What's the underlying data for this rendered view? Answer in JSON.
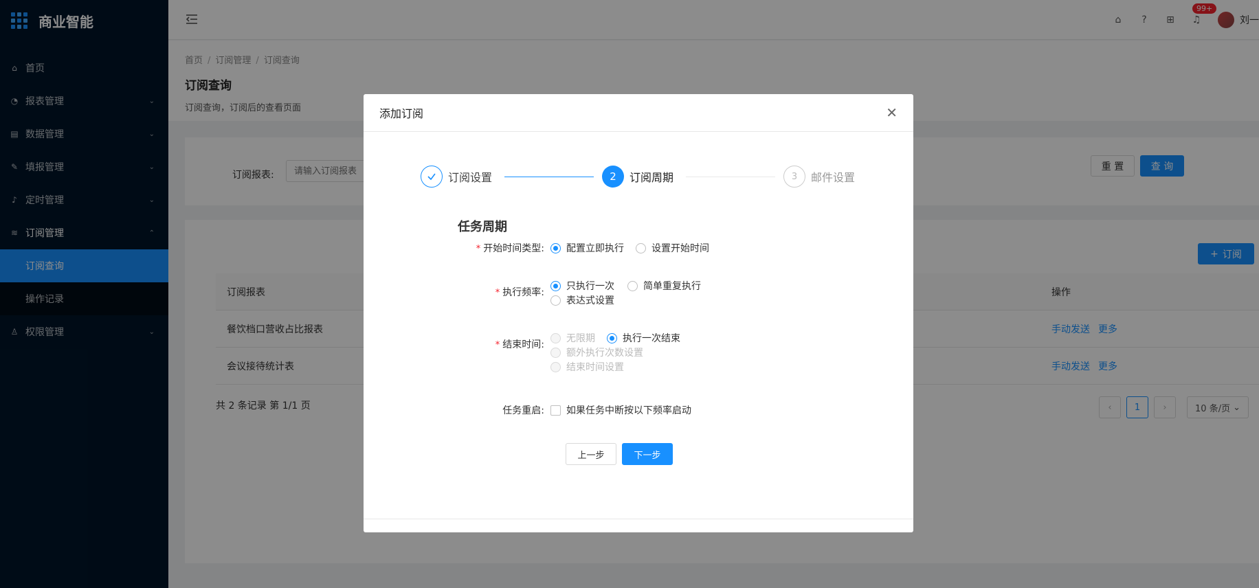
{
  "app": {
    "name": "商业智能"
  },
  "sidebar": {
    "items": [
      {
        "label": "首页",
        "icon": "home-icon"
      },
      {
        "label": "报表管理",
        "icon": "dashboard-icon"
      },
      {
        "label": "数据管理",
        "icon": "database-icon"
      },
      {
        "label": "填报管理",
        "icon": "edit-icon"
      },
      {
        "label": "定时管理",
        "icon": "bell-icon"
      },
      {
        "label": "订阅管理",
        "icon": "wifi-icon"
      },
      {
        "label": "权限管理",
        "icon": "user-icon"
      }
    ],
    "sub_items": [
      {
        "label": "订阅查询"
      },
      {
        "label": "操作记录"
      }
    ]
  },
  "header": {
    "badge": "99+",
    "user_name": "刘一"
  },
  "breadcrumb": [
    "首页",
    "订阅管理",
    "订阅查询"
  ],
  "page": {
    "title": "订阅查询",
    "description": "订阅查询，订阅后的查看页面"
  },
  "search": {
    "label": "订阅报表:",
    "placeholder": "请输入订阅报表",
    "reset_label": "重 置",
    "query_label": "查 询"
  },
  "table": {
    "add_label": "订阅",
    "columns": [
      "订阅报表",
      "操作"
    ],
    "rows": [
      {
        "report": "餐饮档口营收占比报表",
        "actions": [
          "手动发送",
          "更多"
        ]
      },
      {
        "report": "会议接待统计表",
        "actions": [
          "手动发送",
          "更多"
        ]
      }
    ],
    "summary": "共 2 条记录 第 1/1 页",
    "current_page": "1",
    "page_size": "10 条/页"
  },
  "modal": {
    "title": "添加订阅",
    "steps": [
      {
        "label": "订阅设置",
        "status": "done"
      },
      {
        "label": "订阅周期",
        "number": "2",
        "status": "current"
      },
      {
        "label": "邮件设置",
        "number": "3",
        "status": "wait"
      }
    ],
    "section_title": "任务周期",
    "fields": {
      "start_type": {
        "label": "开始时间类型:",
        "options": [
          "配置立即执行",
          "设置开始时间"
        ],
        "selected": "配置立即执行"
      },
      "frequency": {
        "label": "执行频率:",
        "options": [
          "只执行一次",
          "简单重复执行",
          "表达式设置"
        ],
        "selected": "只执行一次"
      },
      "end_time": {
        "label": "结束时间:",
        "options": [
          "无限期",
          "执行一次结束",
          "额外执行次数设置",
          "结束时间设置"
        ],
        "selected": "执行一次结束"
      },
      "restart": {
        "label": "任务重启:",
        "checkbox_label": "如果任务中断按以下频率启动",
        "checked": false
      }
    },
    "prev_label": "上一步",
    "next_label": "下一步"
  },
  "colors": {
    "primary": "#1890ff",
    "sidebar_bg": "#001529",
    "required": "#f5222d"
  }
}
